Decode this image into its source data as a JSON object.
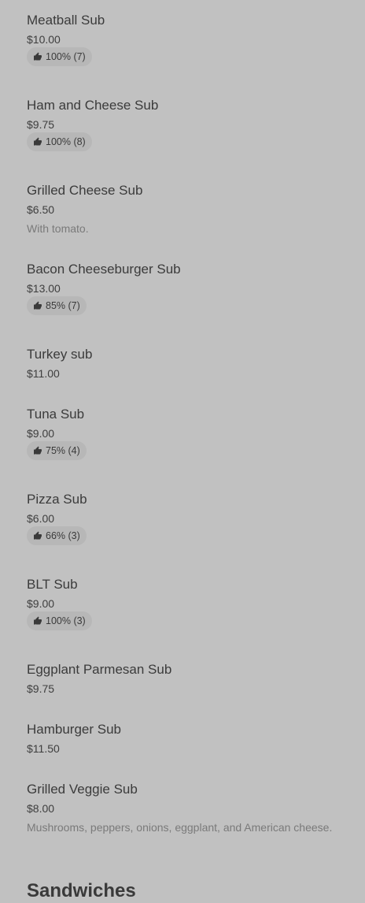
{
  "menu": {
    "items": [
      {
        "name": "Meatball Sub",
        "price": "$10.00",
        "rating": "100% (7)"
      },
      {
        "name": "Ham and Cheese Sub",
        "price": "$9.75",
        "rating": "100% (8)"
      },
      {
        "name": "Grilled Cheese Sub",
        "price": "$6.50",
        "description": "With tomato."
      },
      {
        "name": "Bacon Cheeseburger Sub",
        "price": "$13.00",
        "rating": "85% (7)"
      },
      {
        "name": "Turkey sub",
        "price": "$11.00"
      },
      {
        "name": "Tuna Sub",
        "price": "$9.00",
        "rating": "75% (4)"
      },
      {
        "name": "Pizza Sub",
        "price": "$6.00",
        "rating": "66% (3)"
      },
      {
        "name": "BLT Sub",
        "price": "$9.00",
        "rating": "100% (3)"
      },
      {
        "name": "Eggplant Parmesan Sub",
        "price": "$9.75"
      },
      {
        "name": "Hamburger Sub",
        "price": "$11.50"
      },
      {
        "name": "Grilled Veggie Sub",
        "price": "$8.00",
        "description": "Mushrooms, peppers, onions, eggplant, and American cheese."
      }
    ]
  },
  "next_section": {
    "title": "Sandwiches"
  },
  "icons": {
    "rating": "thumbs-up-icon"
  }
}
